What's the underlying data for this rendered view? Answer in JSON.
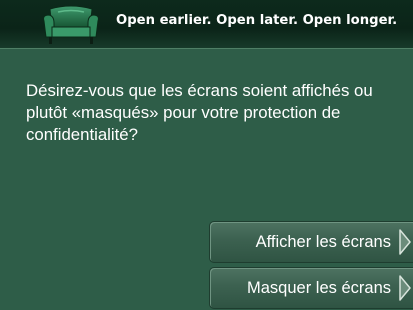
{
  "header": {
    "tagline": "Open earlier. Open later. Open longer.",
    "logo_icon": "armchair-icon"
  },
  "prompt": {
    "question": "Désirez-vous que les écrans soient affichés ou plutôt «masqués» pour votre protection de confidentialité?"
  },
  "choices": [
    {
      "label": "Afficher les écrans",
      "icon": "arrow-right-icon"
    },
    {
      "label": "Masquer les écrans",
      "icon": "arrow-right-icon"
    }
  ],
  "colors": {
    "background": "#2e5d48",
    "header": "#0b2418",
    "text": "#ffffff",
    "button": "#3c6150"
  }
}
